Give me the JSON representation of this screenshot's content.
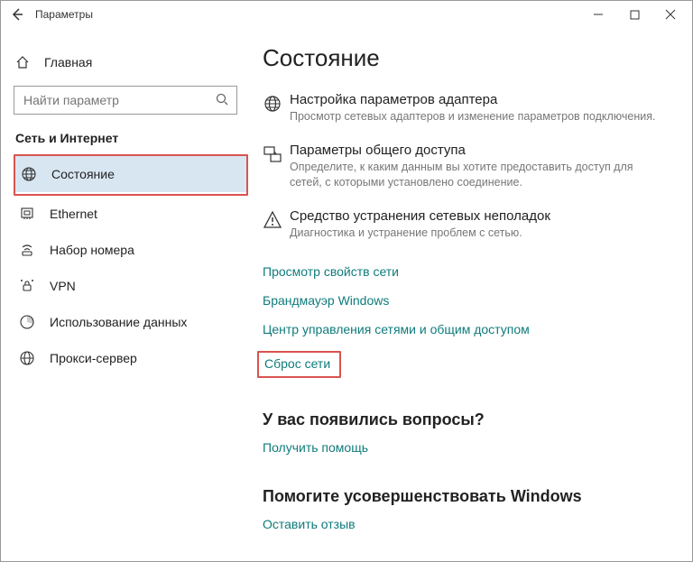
{
  "titlebar": {
    "title": "Параметры"
  },
  "sidebar": {
    "home_label": "Главная",
    "search_placeholder": "Найти параметр",
    "section_header": "Сеть и Интернет",
    "items": [
      {
        "label": "Состояние"
      },
      {
        "label": "Ethernet"
      },
      {
        "label": "Набор номера"
      },
      {
        "label": "VPN"
      },
      {
        "label": "Использование данных"
      },
      {
        "label": "Прокси-сервер"
      }
    ]
  },
  "content": {
    "page_title": "Состояние",
    "options": [
      {
        "title": "Настройка параметров адаптера",
        "sub": "Просмотр сетевых адаптеров и изменение параметров подключения."
      },
      {
        "title": "Параметры общего доступа",
        "sub": "Определите, к каким данным вы хотите предоставить доступ для сетей, с которыми установлено соединение."
      },
      {
        "title": "Средство устранения сетевых неполадок",
        "sub": "Диагностика и устранение проблем с сетью."
      }
    ],
    "links": [
      "Просмотр свойств сети",
      "Брандмауэр Windows",
      "Центр управления сетями и общим доступом",
      "Сброс сети"
    ],
    "questions_title": "У вас появились вопросы?",
    "help_link": "Получить помощь",
    "improve_title": "Помогите усовершенствовать Windows",
    "feedback_link": "Оставить отзыв"
  }
}
